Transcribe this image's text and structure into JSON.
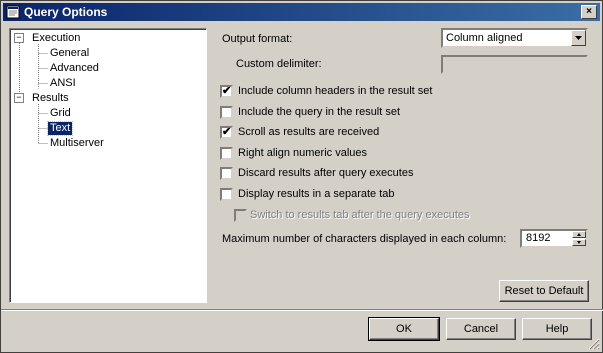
{
  "window": {
    "title": "Query Options"
  },
  "tree": {
    "execution": "Execution",
    "general": "General",
    "advanced": "Advanced",
    "ansi": "ANSI",
    "results": "Results",
    "grid": "Grid",
    "text": "Text",
    "multiserver": "Multiserver",
    "expanded_glyph": "−",
    "selected": "Text"
  },
  "options": {
    "output_format_label": "Output format:",
    "output_format_value": "Column aligned",
    "custom_delimiter_label": "Custom delimiter:",
    "custom_delimiter_value": "",
    "include_headers": {
      "label": "Include column headers in the result set",
      "checked": true
    },
    "include_query": {
      "label": "Include the query in the result set",
      "checked": false
    },
    "scroll_results": {
      "label": "Scroll as results are received",
      "checked": true
    },
    "right_align": {
      "label": "Right align numeric values",
      "checked": false
    },
    "discard_results": {
      "label": "Discard results after query executes",
      "checked": false
    },
    "separate_tab": {
      "label": "Display results in a separate tab",
      "checked": false
    },
    "switch_tab": {
      "label": "Switch to results tab after the query executes",
      "checked": false,
      "enabled": false
    },
    "max_chars_label": "Maximum number of characters displayed in each column:",
    "max_chars_value": "8192",
    "check_glyph": "✔"
  },
  "buttons": {
    "reset": "Reset to Default",
    "ok": "OK",
    "cancel": "Cancel",
    "help": "Help",
    "close_glyph": "×"
  }
}
